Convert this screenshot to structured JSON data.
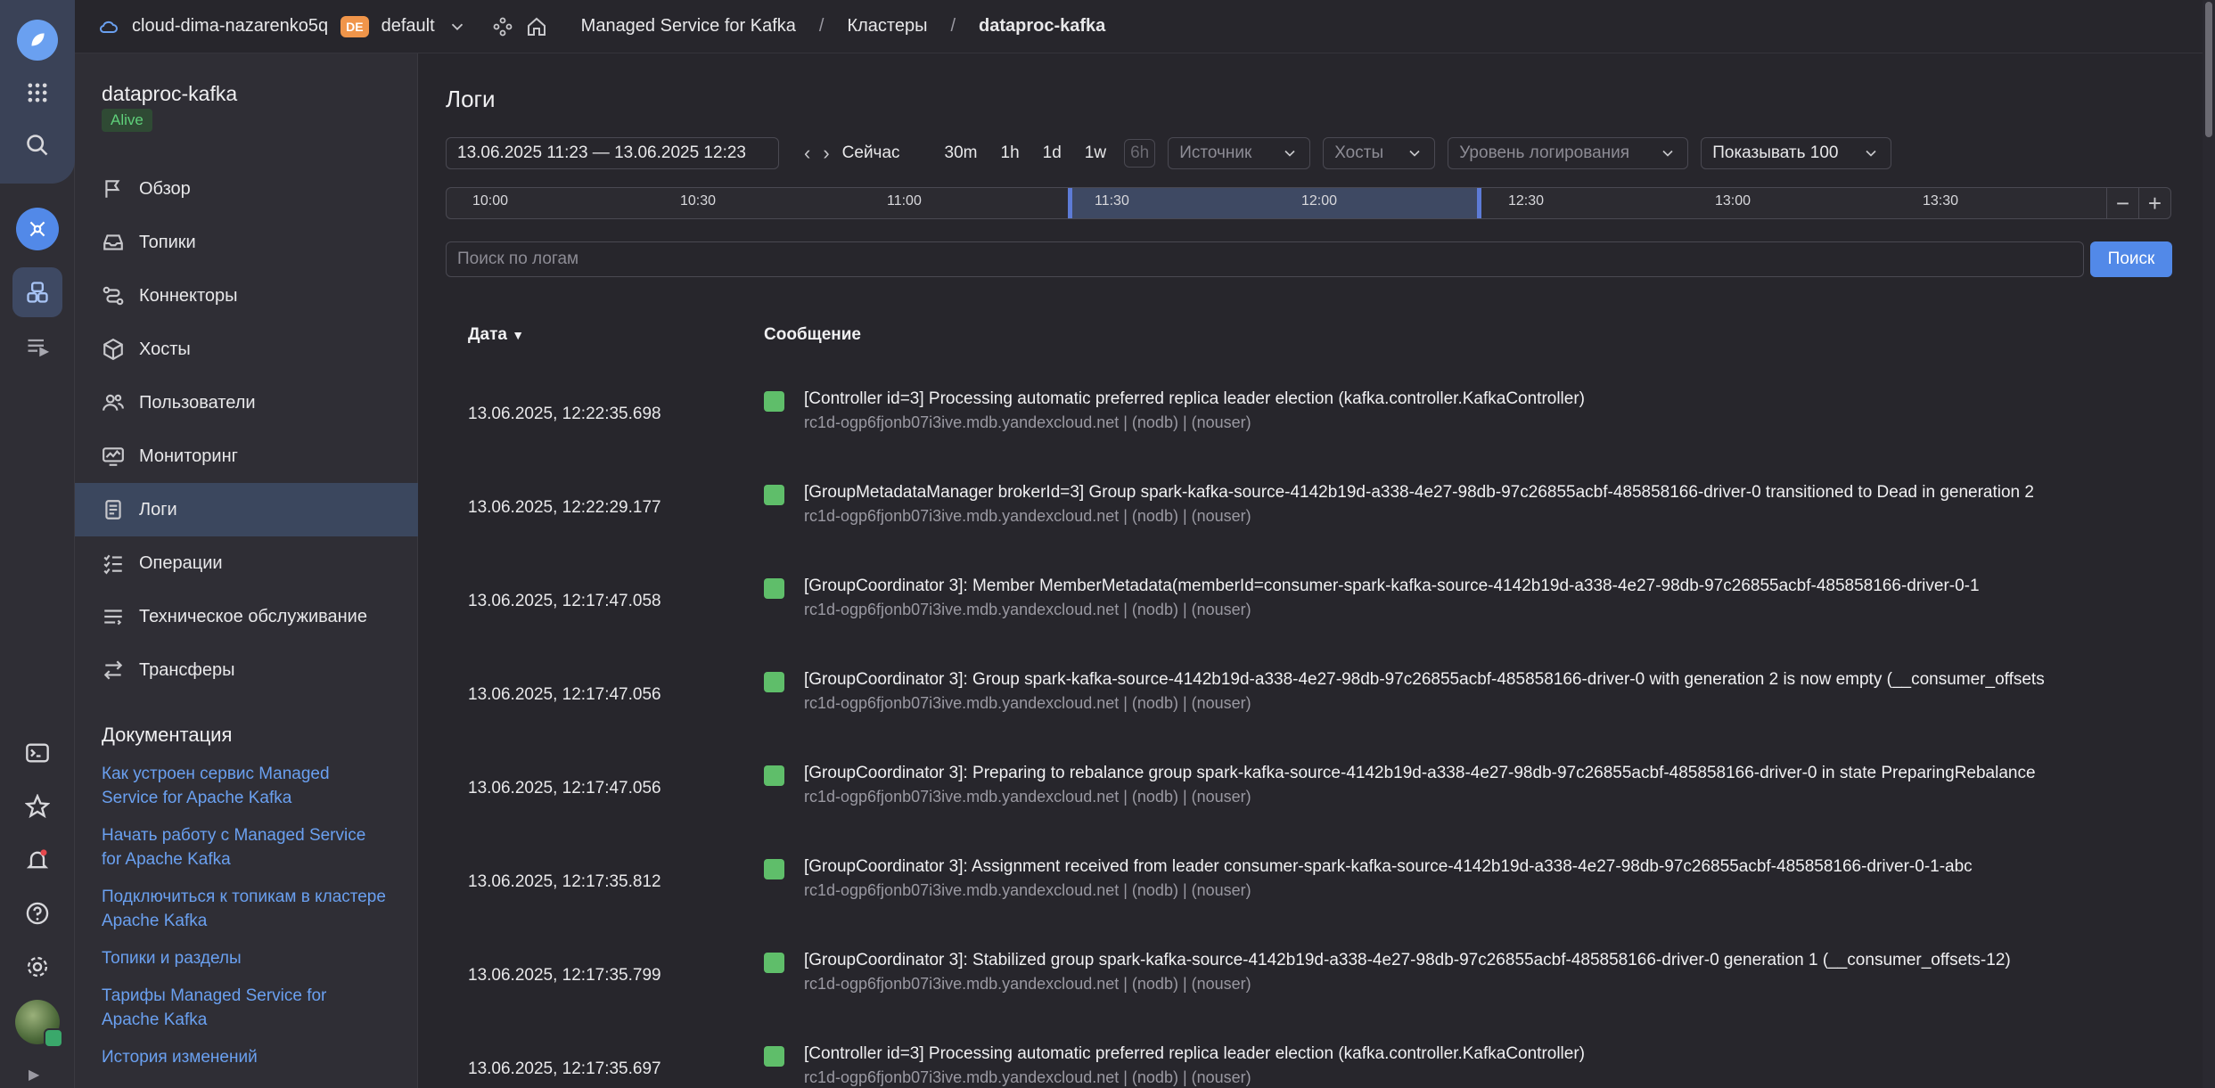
{
  "header": {
    "cloud": "cloud-dima-nazarenko5q",
    "folder_badge": "DE",
    "folder": "default",
    "breadcrumbs": [
      "Managed Service for Kafka",
      "Кластеры",
      "dataproc-kafka"
    ]
  },
  "sidebar": {
    "cluster_name": "dataproc-kafka",
    "status": "Alive",
    "items": [
      {
        "label": "Обзор",
        "icon": "flag-icon"
      },
      {
        "label": "Топики",
        "icon": "inbox-icon"
      },
      {
        "label": "Коннекторы",
        "icon": "connectors-icon"
      },
      {
        "label": "Хосты",
        "icon": "cube-icon"
      },
      {
        "label": "Пользователи",
        "icon": "users-icon"
      },
      {
        "label": "Мониторинг",
        "icon": "monitor-icon"
      },
      {
        "label": "Логи",
        "icon": "logs-icon",
        "active": true
      },
      {
        "label": "Операции",
        "icon": "checklist-icon"
      },
      {
        "label": "Техническое обслуживание",
        "icon": "maintenance-icon"
      },
      {
        "label": "Трансферы",
        "icon": "transfer-icon"
      }
    ],
    "docs_title": "Документация",
    "docs": [
      "Как устроен сервис Managed Service for Apache Kafka",
      "Начать работу с Managed Service for Apache Kafka",
      "Подключиться к топикам в кластере Apache Kafka",
      "Топики и разделы",
      "Тарифы Managed Service for Apache Kafka",
      "История изменений"
    ]
  },
  "main": {
    "title": "Логи",
    "date_range": "13.06.2025 11:23 — 13.06.2025 12:23",
    "now_label": "Сейчас",
    "ranges": [
      "30m",
      "1h",
      "1d",
      "1w",
      "6h"
    ],
    "source_placeholder": "Источник",
    "hosts_placeholder": "Хосты",
    "level_placeholder": "Уровень логирования",
    "show_label": "Показывать 100",
    "timeline_ticks": [
      "10:00",
      "10:30",
      "11:00",
      "11:30",
      "12:00",
      "12:30",
      "13:00",
      "13:30"
    ],
    "search_placeholder": "Поиск по логам",
    "search_button": "Поиск",
    "col_date": "Дата",
    "col_message": "Сообщение",
    "logs": [
      {
        "date": "13.06.2025, 12:22:35.698",
        "message": "[Controller id=3] Processing automatic preferred replica leader election (kafka.controller.KafkaController)",
        "meta": "rc1d-ogp6fjonb07i3ive.mdb.yandexcloud.net | (nodb) | (nouser)"
      },
      {
        "date": "13.06.2025, 12:22:29.177",
        "message": "[GroupMetadataManager brokerId=3] Group spark-kafka-source-4142b19d-a338-4e27-98db-97c26855acbf-485858166-driver-0 transitioned to Dead in generation 2",
        "meta": "rc1d-ogp6fjonb07i3ive.mdb.yandexcloud.net | (nodb) | (nouser)"
      },
      {
        "date": "13.06.2025, 12:17:47.058",
        "message": "[GroupCoordinator 3]: Member MemberMetadata(memberId=consumer-spark-kafka-source-4142b19d-a338-4e27-98db-97c26855acbf-485858166-driver-0-1",
        "meta": "rc1d-ogp6fjonb07i3ive.mdb.yandexcloud.net | (nodb) | (nouser)"
      },
      {
        "date": "13.06.2025, 12:17:47.056",
        "message": "[GroupCoordinator 3]: Group spark-kafka-source-4142b19d-a338-4e27-98db-97c26855acbf-485858166-driver-0 with generation 2 is now empty (__consumer_offsets",
        "meta": "rc1d-ogp6fjonb07i3ive.mdb.yandexcloud.net | (nodb) | (nouser)"
      },
      {
        "date": "13.06.2025, 12:17:47.056",
        "message": "[GroupCoordinator 3]: Preparing to rebalance group spark-kafka-source-4142b19d-a338-4e27-98db-97c26855acbf-485858166-driver-0 in state PreparingRebalance",
        "meta": "rc1d-ogp6fjonb07i3ive.mdb.yandexcloud.net | (nodb) | (nouser)"
      },
      {
        "date": "13.06.2025, 12:17:35.812",
        "message": "[GroupCoordinator 3]: Assignment received from leader consumer-spark-kafka-source-4142b19d-a338-4e27-98db-97c26855acbf-485858166-driver-0-1-abc",
        "meta": "rc1d-ogp6fjonb07i3ive.mdb.yandexcloud.net | (nodb) | (nouser)"
      },
      {
        "date": "13.06.2025, 12:17:35.799",
        "message": "[GroupCoordinator 3]: Stabilized group spark-kafka-source-4142b19d-a338-4e27-98db-97c26855acbf-485858166-driver-0 generation 1 (__consumer_offsets-12)",
        "meta": "rc1d-ogp6fjonb07i3ive.mdb.yandexcloud.net | (nodb) | (nouser)"
      },
      {
        "date": "13.06.2025, 12:17:35.697",
        "message": "[Controller id=3] Processing automatic preferred replica leader election (kafka.controller.KafkaController)",
        "meta": "rc1d-ogp6fjonb07i3ive.mdb.yandexcloud.net | (nodb) | (nouser)"
      }
    ]
  }
}
